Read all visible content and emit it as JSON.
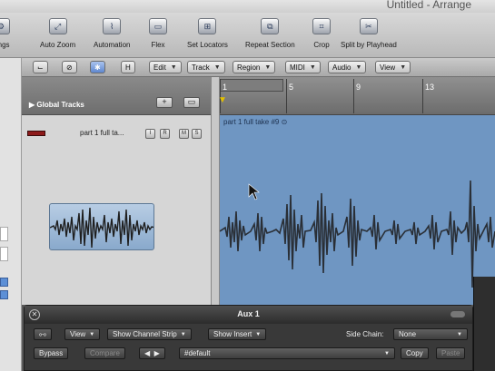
{
  "window": {
    "title": "Untitled - Arrange"
  },
  "toolbar": {
    "items": [
      {
        "label": "ttings",
        "icon": "settings-icon"
      },
      {
        "label": "Auto Zoom",
        "icon": "auto-zoom-icon"
      },
      {
        "label": "Automation",
        "icon": "automation-icon"
      },
      {
        "label": "Flex",
        "icon": "flex-icon"
      },
      {
        "label": "Set Locators",
        "icon": "set-locators-icon"
      },
      {
        "label": "Repeat Section",
        "icon": "repeat-section-icon"
      },
      {
        "label": "Crop",
        "icon": "crop-icon"
      },
      {
        "label": "Split by Playhead",
        "icon": "split-icon"
      }
    ]
  },
  "menubar": {
    "tool_buttons": [
      "⌙",
      "⊘",
      "✱",
      "H"
    ],
    "menus": [
      "Edit",
      "Track",
      "Region",
      "MIDI",
      "Audio",
      "View"
    ]
  },
  "global_tracks": {
    "label": "Global Tracks",
    "add": "+",
    "more": "▭"
  },
  "track": {
    "name": "part 1 full ta...",
    "buttons": [
      "I",
      "R",
      "M",
      "S"
    ]
  },
  "ruler": {
    "bars": [
      "1",
      "5",
      "9",
      "13"
    ]
  },
  "region": {
    "label": "part 1 full take #9 ⊙"
  },
  "aux": {
    "title": "Aux 1",
    "link_icon": "link-icon",
    "view_label": "View",
    "channel_strip_label": "Show Channel Strip",
    "insert_label": "Show Insert",
    "side_chain_label": "Side Chain:",
    "side_chain_value": "None",
    "bypass_label": "Bypass",
    "compare_label": "Compare",
    "preset_value": "#default",
    "copy_label": "Copy",
    "paste_label": "Paste"
  },
  "colors": {
    "region": "#6f96c2",
    "meter": "#8d1a1a",
    "playhead": "#e3c000"
  }
}
